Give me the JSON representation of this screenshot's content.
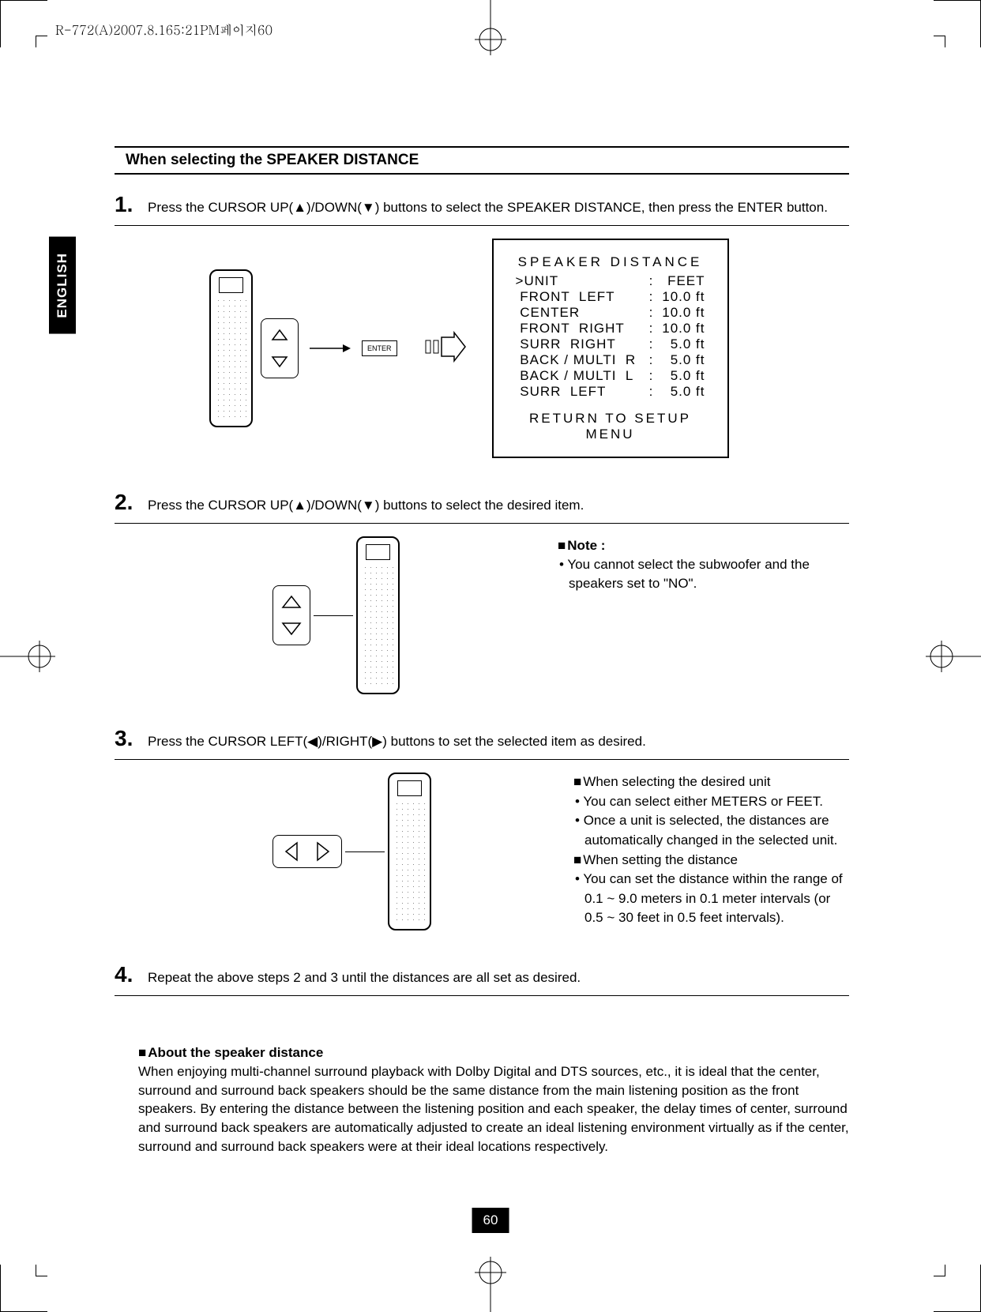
{
  "file_header": "R-772(A)2007.8.165:21PM페이지60",
  "side_tab": "ENGLISH",
  "section_title": "When selecting the SPEAKER DISTANCE",
  "steps": {
    "s1": {
      "num": "1.",
      "text": "Press the CURSOR UP(▲)/DOWN(▼) buttons to select the SPEAKER DISTANCE, then press the ENTER button."
    },
    "s2": {
      "num": "2.",
      "text": "Press the CURSOR UP(▲)/DOWN(▼) buttons to select the desired item.",
      "note_title": "Note :",
      "note_body": "You cannot select the subwoofer and the speakers set to \"NO\"."
    },
    "s3": {
      "num": "3.",
      "text": "Press the CURSOR LEFT(◀)/RIGHT(▶) buttons to set the selected item as desired.",
      "h1": "When selecting the desired unit",
      "b1": "You can select either METERS or FEET.",
      "b2": "Once a unit is selected, the distances are automatically changed in the selected unit.",
      "h2": "When setting the distance",
      "b3": "You can set the distance within the range of 0.1 ~ 9.0 meters in 0.1 meter intervals (or 0.5 ~ 30 feet in 0.5 feet intervals)."
    },
    "s4": {
      "num": "4.",
      "text": "Repeat the above steps 2 and 3 until the distances are all set as desired."
    }
  },
  "buttons": {
    "enter": "ENTER"
  },
  "osd": {
    "title": "SPEAKER  DISTANCE",
    "rows": [
      {
        "label": ">UNIT",
        "val": "FEET"
      },
      {
        "label": " FRONT  LEFT",
        "val": "10.0 ft"
      },
      {
        "label": " CENTER",
        "val": "10.0 ft"
      },
      {
        "label": " FRONT  RIGHT",
        "val": "10.0 ft"
      },
      {
        "label": " SURR  RIGHT",
        "val": "5.0 ft"
      },
      {
        "label": " BACK / MULTI  R",
        "val": "5.0 ft"
      },
      {
        "label": " BACK / MULTI  L",
        "val": "5.0 ft"
      },
      {
        "label": " SURR  LEFT",
        "val": "5.0 ft"
      }
    ],
    "return": "RETURN  TO  SETUP  MENU"
  },
  "about": {
    "title": "About the speaker distance",
    "body": "When enjoying multi-channel surround playback with Dolby Digital and DTS sources, etc., it is ideal that the center, surround and surround back speakers should be the same distance from the main listening position as the front speakers. By entering the distance between the listening position and each speaker, the delay times of center, surround and surround back speakers are automatically adjusted to create an ideal listening environment virtually as if the center, surround and surround back speakers were at their ideal locations respectively."
  },
  "page_number": "60"
}
